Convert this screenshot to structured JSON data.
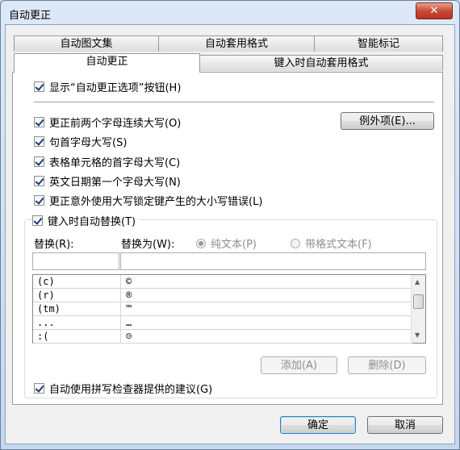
{
  "window": {
    "title": "自动更正",
    "close_label": "✕"
  },
  "tabs": {
    "row1": [
      {
        "label": "自动图文集"
      },
      {
        "label": "自动套用格式"
      },
      {
        "label": "智能标记"
      }
    ],
    "row2": [
      {
        "label": "自动更正"
      },
      {
        "label": "键入时自动套用格式"
      }
    ]
  },
  "options": {
    "show_buttons": "显示“自动更正选项”按钮(H)",
    "two_caps": "更正前两个字母连续大写(O)",
    "sentence_cap": "句首字母大写(S)",
    "table_cap": "表格单元格的首字母大写(C)",
    "day_cap": "英文日期第一个字母大写(N)",
    "caps_lock": "更正意外使用大写锁定键产生的大小写错误(L)",
    "exceptions_button": "例外项(E)...",
    "replace_as_you_type": "键入时自动替换(T)"
  },
  "replace": {
    "replace_label": "替换(R):",
    "with_label": "替换为(W):",
    "plain_text": "纯文本(P)",
    "formatted_text": "带格式文本(F)",
    "replace_value": "",
    "with_value": "",
    "entries": [
      {
        "from": "(c)",
        "to": "©"
      },
      {
        "from": "(r)",
        "to": "®"
      },
      {
        "from": "(tm)",
        "to": "™"
      },
      {
        "from": "...",
        "to": "…"
      },
      {
        "from": ":(",
        "to": "☹"
      }
    ],
    "add_button": "添加(A)",
    "delete_button": "删除(D)"
  },
  "spell_suggest": "自动使用拼写检查器提供的建议(G)",
  "footer": {
    "ok": "确定",
    "cancel": "取消"
  }
}
